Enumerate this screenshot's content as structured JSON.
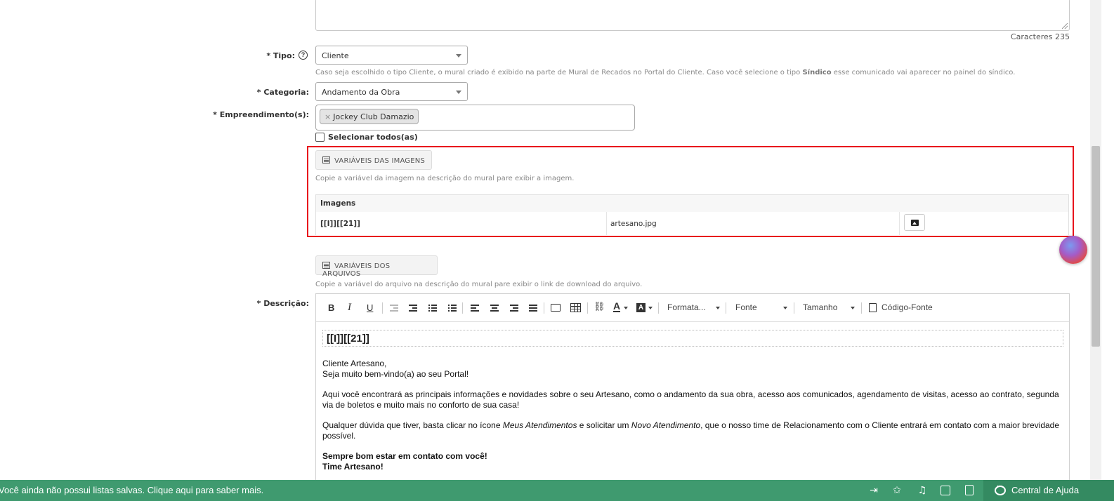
{
  "description_field": {
    "char_count": "Caracteres 235"
  },
  "tipo": {
    "label": "* Tipo:",
    "value": "Cliente",
    "help_prefix": "Caso seja escolhido o tipo Cliente, o mural criado é exibido na parte de Mural de Recados no Portal do Cliente. Caso você selecione o tipo ",
    "help_bold": "Síndico",
    "help_suffix": " esse comunicado vai aparecer no painel do síndico."
  },
  "categoria": {
    "label": "* Categoria:",
    "value": "Andamento da Obra"
  },
  "empreendimentos": {
    "label": "* Empreendimento(s):",
    "tag_remove": "×",
    "tag": "Jockey Club Damazio",
    "select_all": "Selecionar todos(as)"
  },
  "variaveis_imagens": {
    "button": "VARIÁVEIS DAS IMAGENS",
    "help": "Copie a variável da imagem na descrição do mural pare exibir a imagem.",
    "table_header": "Imagens",
    "rows": [
      {
        "variable": "[[I]][[21]]",
        "file": "artesano.jpg"
      }
    ]
  },
  "variaveis_arquivos": {
    "button": "VARIÁVEIS DOS ARQUIVOS",
    "help": "Copie a variável do arquivo na descrição do mural pare exibir o link de download do arquivo."
  },
  "descricao": {
    "label": "* Descrição:",
    "toolbar": {
      "bold": "B",
      "italic": "I",
      "underline": "U",
      "formatting": "Formata...",
      "font": "Fonte",
      "size": "Tamanho",
      "source": "Código-Fonte"
    },
    "variable_line": "[[I]][[21]]",
    "greeting_1": "Cliente Artesano,",
    "greeting_2": "Seja muito bem-vindo(a) ao seu Portal!",
    "paragraph_1": "Aqui você encontrará as principais informações e novidades sobre o seu Artesano, como o andamento da sua obra, acesso aos comunicados, agendamento de visitas, acesso ao contrato, segunda via de boletos e muito mais no conforto de sua casa!",
    "p2_a": "Qualquer dúvida que tiver, basta clicar no ícone ",
    "p2_b": "Meus Atendimentos",
    "p2_c": " e solicitar um ",
    "p2_d": "Novo Atendimento",
    "p2_e": ", que o nosso time de Relacionamento com o Cliente entrará em contato com a maior brevidade possível.",
    "closing_1": "Sempre bom estar em contato com você!",
    "closing_2": "Time Artesano!"
  },
  "bottom_bar": {
    "message": "Você ainda não possui listas salvas. Clique aqui para saber mais.",
    "help_center": "Central de Ajuda",
    "icons": [
      "login-icon",
      "star-icon",
      "bell-icon",
      "calendar-icon",
      "calculator-icon",
      "chat-icon"
    ]
  },
  "colors": {
    "highlight": "#e8141c",
    "bottom_bar": "#3f9a6f"
  }
}
